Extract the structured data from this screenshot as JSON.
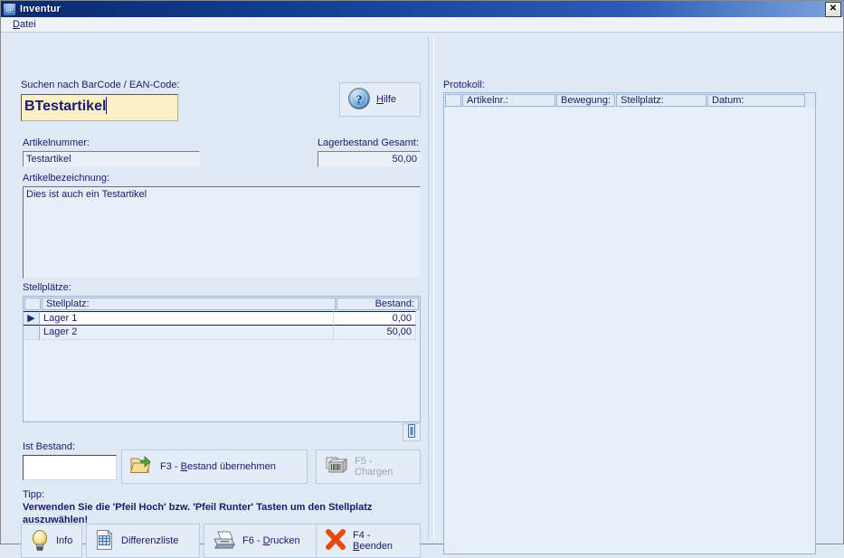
{
  "window": {
    "title": "Inventur",
    "app_icon": "at-icon",
    "close_label": "✕"
  },
  "menu": {
    "items": [
      {
        "label": "Datei",
        "accel": "D"
      }
    ]
  },
  "left": {
    "search_label": "Suchen nach BarCode / EAN-Code:",
    "search_value": "BTestartikel",
    "help_button": {
      "label": "Hilfe",
      "accel": "H",
      "icon": "question-mark-icon"
    },
    "article_number_label": "Artikelnummer:",
    "article_number_value": "Testartikel",
    "stock_total_label": "Lagerbestand Gesamt:",
    "stock_total_value": "50,00",
    "article_description_label": "Artikelbezeichnung:",
    "article_description_value": "Dies ist auch ein Testartikel",
    "bins_label": "Stellplätze:",
    "bins_grid": {
      "columns": [
        "Stellplatz:",
        "Bestand:"
      ],
      "rows": [
        {
          "selected": true,
          "marker": "▶",
          "stellplatz": "Lager 1",
          "bestand": "0,00"
        },
        {
          "selected": false,
          "marker": "",
          "stellplatz": "Lager 2",
          "bestand": "50,00"
        }
      ]
    },
    "grid_tool_button": {
      "icon": "barcode-scanner-icon",
      "label": ""
    },
    "actual_stock_label": "Ist Bestand:",
    "actual_stock_value": "",
    "take_stock_button": {
      "label": "F3 - Bestand übernehmen",
      "accel": "B",
      "icon": "folder-import-icon",
      "disabled": false
    },
    "batches_button": {
      "label": "F5 - Chargen",
      "accel": "",
      "icon": "barcode-boxes-icon",
      "disabled": true
    },
    "tip_title": "Tipp:",
    "tip_text": "Verwenden Sie die 'Pfeil Hoch' bzw. 'Pfeil Runter' Tasten um den Stellplatz auszuwählen!",
    "footer_buttons": [
      {
        "label": "Info",
        "accel": "",
        "icon": "lightbulb-icon"
      },
      {
        "label": "Differenzliste",
        "accel": "",
        "icon": "document-table-icon"
      },
      {
        "label": "F6 - Drucken",
        "accel": "D",
        "icon": "printer-icon"
      },
      {
        "label": "F4 - Beenden",
        "accel": "B",
        "icon": "red-x-icon"
      }
    ]
  },
  "right": {
    "protocol_label": "Protokoll:",
    "protocol_grid": {
      "columns": [
        "Artikelnr.:",
        "Bewegung:",
        "Stellplatz:",
        "Datum:"
      ],
      "rows": []
    }
  },
  "colors": {
    "window_bg": "#dfe8f5",
    "title_start": "#0b2a70",
    "title_end": "#7ea4de",
    "text": "#1b1b6b",
    "search_field_bg": "#fdf0c8",
    "grid_border": "#9bb6d4",
    "button_face": "#e4ecf7",
    "button_border": "#b7cbe2",
    "disabled_text": "#9aa6b5"
  }
}
